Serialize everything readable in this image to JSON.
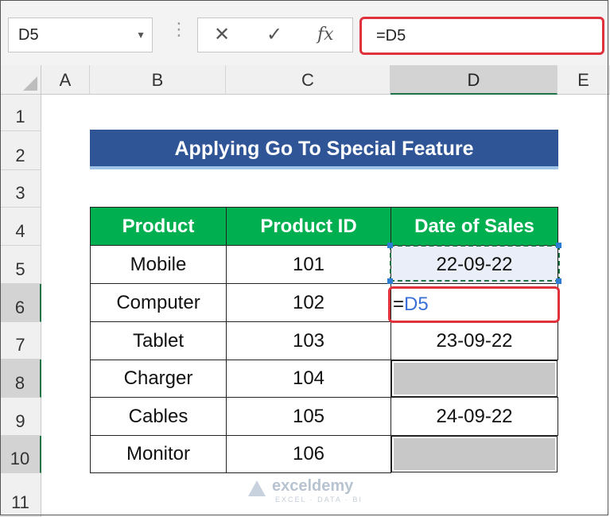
{
  "formula_bar": {
    "name_box": "D5",
    "cancel_icon": "✕",
    "enter_icon": "✓",
    "fx_icon": "fx",
    "formula": "=D5"
  },
  "columns": [
    "A",
    "B",
    "C",
    "D",
    "E"
  ],
  "rows": [
    "1",
    "2",
    "3",
    "4",
    "5",
    "6",
    "7",
    "8",
    "9",
    "10",
    "11"
  ],
  "title": "Applying Go To Special Feature",
  "table": {
    "headers": [
      "Product",
      "Product ID",
      "Date of Sales"
    ],
    "rows": [
      [
        "Mobile",
        "101",
        "22-09-22"
      ],
      [
        "Computer",
        "102",
        "=D5"
      ],
      [
        "Tablet",
        "103",
        "23-09-22"
      ],
      [
        "Charger",
        "104",
        ""
      ],
      [
        "Cables",
        "105",
        "24-09-22"
      ],
      [
        "Monitor",
        "106",
        ""
      ]
    ]
  },
  "edit_cell": {
    "prefix": "=",
    "ref": "D5"
  },
  "watermark": {
    "name": "exceldemy",
    "tagline": "EXCEL · DATA · BI"
  },
  "colors": {
    "title_bg": "#2f5597",
    "header_bg": "#00b050",
    "highlight": "#e0323c",
    "blank_cell": "#c8c8c8"
  }
}
